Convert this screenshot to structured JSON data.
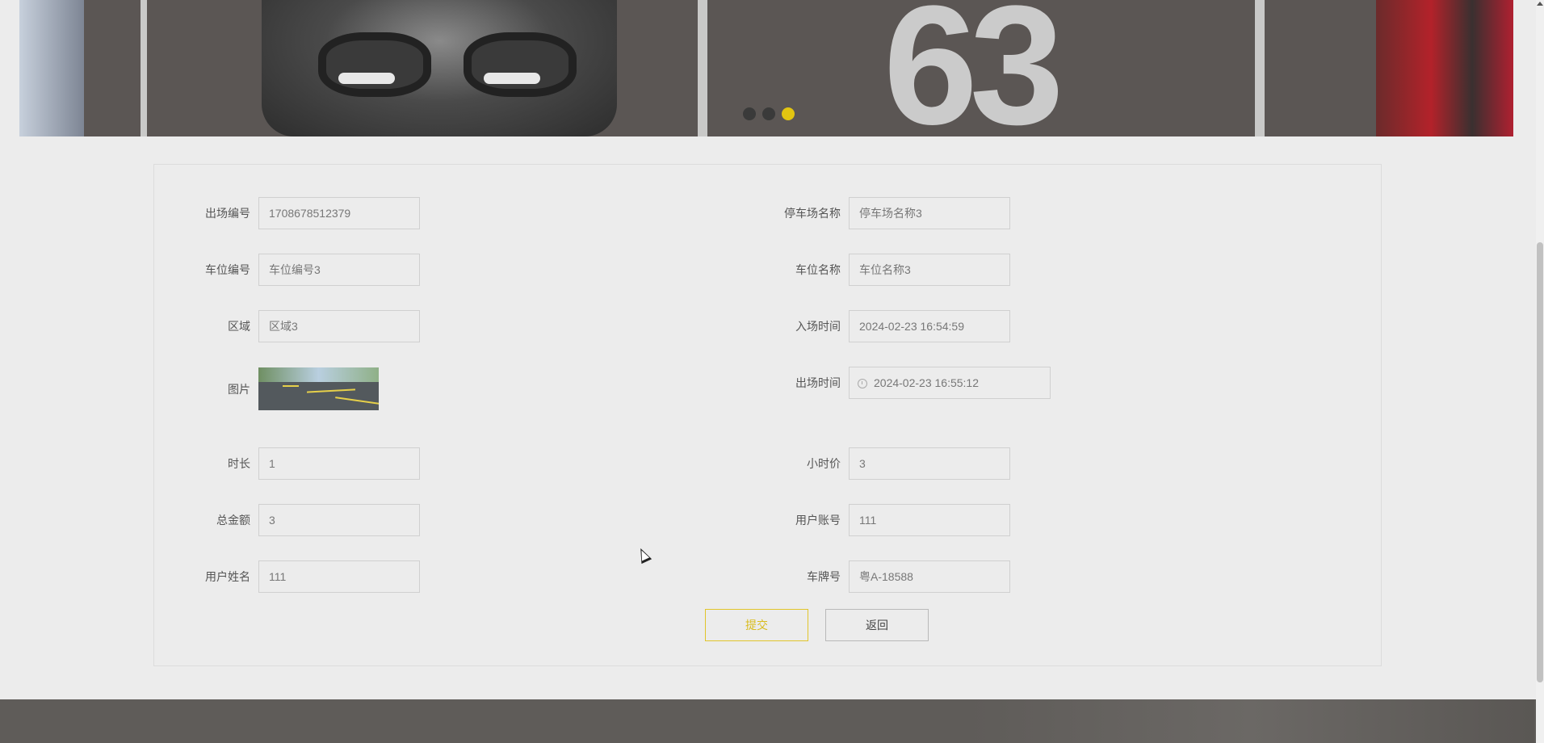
{
  "carousel": {
    "plate_number_art": "63",
    "dots": [
      {
        "active": false
      },
      {
        "active": false
      },
      {
        "active": true
      }
    ]
  },
  "form": {
    "left": [
      {
        "key": "chuchang_bianhao",
        "label": "出场编号",
        "value": "1708678512379"
      },
      {
        "key": "chewei_bianhao",
        "label": "车位编号",
        "value": "车位编号3"
      },
      {
        "key": "quyu",
        "label": "区域",
        "value": "区域3"
      },
      {
        "key": "tupian",
        "label": "图片",
        "value": ""
      },
      {
        "key": "shichang",
        "label": "时长",
        "value": "1"
      },
      {
        "key": "zongjine",
        "label": "总金额",
        "value": "3"
      },
      {
        "key": "yonghu_xingming",
        "label": "用户姓名",
        "value": "111"
      }
    ],
    "right": [
      {
        "key": "tingchechang_mingcheng",
        "label": "停车场名称",
        "value": "停车场名称3"
      },
      {
        "key": "chewei_mingcheng",
        "label": "车位名称",
        "value": "车位名称3"
      },
      {
        "key": "ruchang_shijian",
        "label": "入场时间",
        "value": "2024-02-23 16:54:59"
      },
      {
        "key": "chuchang_shijian",
        "label": "出场时间",
        "value": "2024-02-23 16:55:12"
      },
      {
        "key": "xiaoshijia",
        "label": "小时价",
        "value": "3"
      },
      {
        "key": "yonghu_zhanghao",
        "label": "用户账号",
        "value": "111"
      },
      {
        "key": "chepaihao",
        "label": "车牌号",
        "value": "粤A-18588"
      }
    ],
    "buttons": {
      "submit": "提交",
      "back": "返回"
    }
  },
  "colors": {
    "accent": "#e2c511",
    "background": "#ececec"
  },
  "icons": {
    "time_field_icon": "clock-icon"
  }
}
